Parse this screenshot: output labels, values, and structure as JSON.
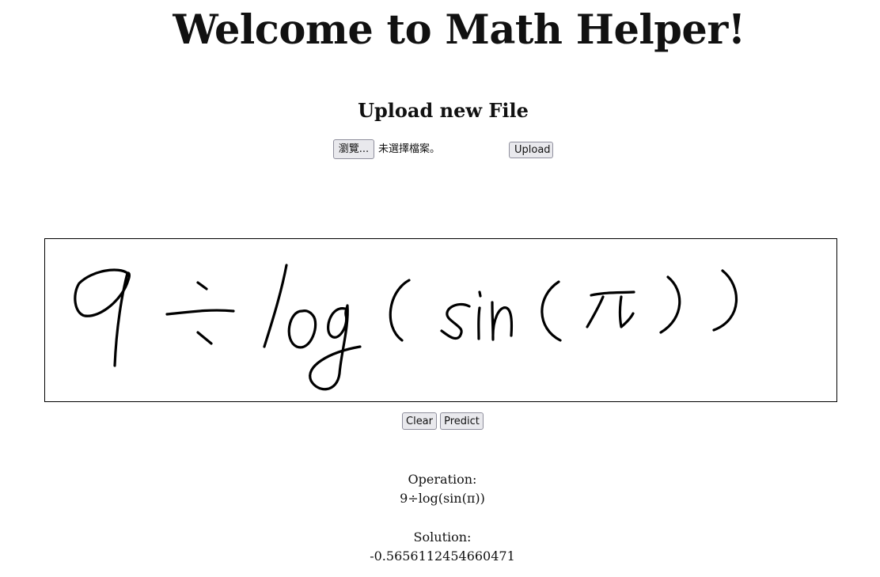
{
  "page": {
    "title": "Welcome to Math Helper!"
  },
  "upload": {
    "title": "Upload new File",
    "browse_label": "瀏覽...",
    "file_status": "未選擇檔案。",
    "upload_label": "Upload"
  },
  "drawing": {
    "name": "handwritten-expression"
  },
  "actions": {
    "clear_label": "Clear",
    "predict_label": "Predict"
  },
  "result": {
    "operation_label": "Operation:",
    "operation_value": "9÷log(sin(π))",
    "solution_label": "Solution:",
    "solution_value": "-0.5656112454660471"
  }
}
